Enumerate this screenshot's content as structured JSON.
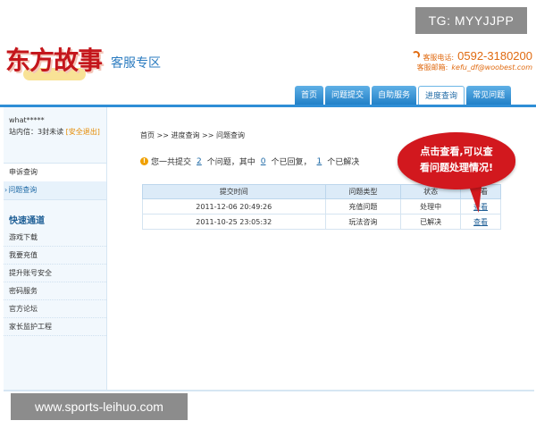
{
  "watermarks": {
    "top": "TG: MYYJJPP",
    "bottom": "www.sports-leihuo.com"
  },
  "header": {
    "logo_text": "东方故事",
    "logo_sub": "客服专区",
    "phone_label": "客服电话:",
    "phone": "0592-3180200",
    "email_label": "客服邮箱:",
    "email": "kefu_df@woobest.com"
  },
  "nav": {
    "tabs": [
      {
        "label": "首页",
        "active": false
      },
      {
        "label": "问题提交",
        "active": false
      },
      {
        "label": "自助服务",
        "active": false
      },
      {
        "label": "进度查询",
        "active": true
      },
      {
        "label": "常见问题",
        "active": false
      }
    ]
  },
  "sidebar": {
    "username": "what*****",
    "msg_prefix": "站内信：3封未读",
    "logout": "[安全退出]",
    "menu": [
      {
        "label": "申诉查询",
        "active": false
      },
      {
        "label": "问题查询",
        "active": true
      }
    ],
    "quick_title": "快速通道",
    "quick_links": [
      "游戏下载",
      "我要充值",
      "提升账号安全",
      "密码服务",
      "官方论坛",
      "家长监护工程"
    ]
  },
  "main": {
    "breadcrumb": "首页 >> 进度查询 >> 问题查询",
    "summary": {
      "prefix": "您一共提交",
      "total": "2",
      "mid1": "个问题，其中",
      "replied": "0",
      "mid2": "个已回复，",
      "solved": "1",
      "suffix": "个已解决"
    },
    "table": {
      "headers": [
        "提交时间",
        "问题类型",
        "状态",
        "查看"
      ],
      "rows": [
        {
          "time": "2011-12-06 20:49:26",
          "type": "充值问题",
          "status": "处理中",
          "action": "查看"
        },
        {
          "time": "2011-10-25 23:05:32",
          "type": "玩法咨询",
          "status": "已解决",
          "action": "查看"
        }
      ]
    },
    "bubble_text": "点击查看,可以查看问题处理情况!"
  }
}
